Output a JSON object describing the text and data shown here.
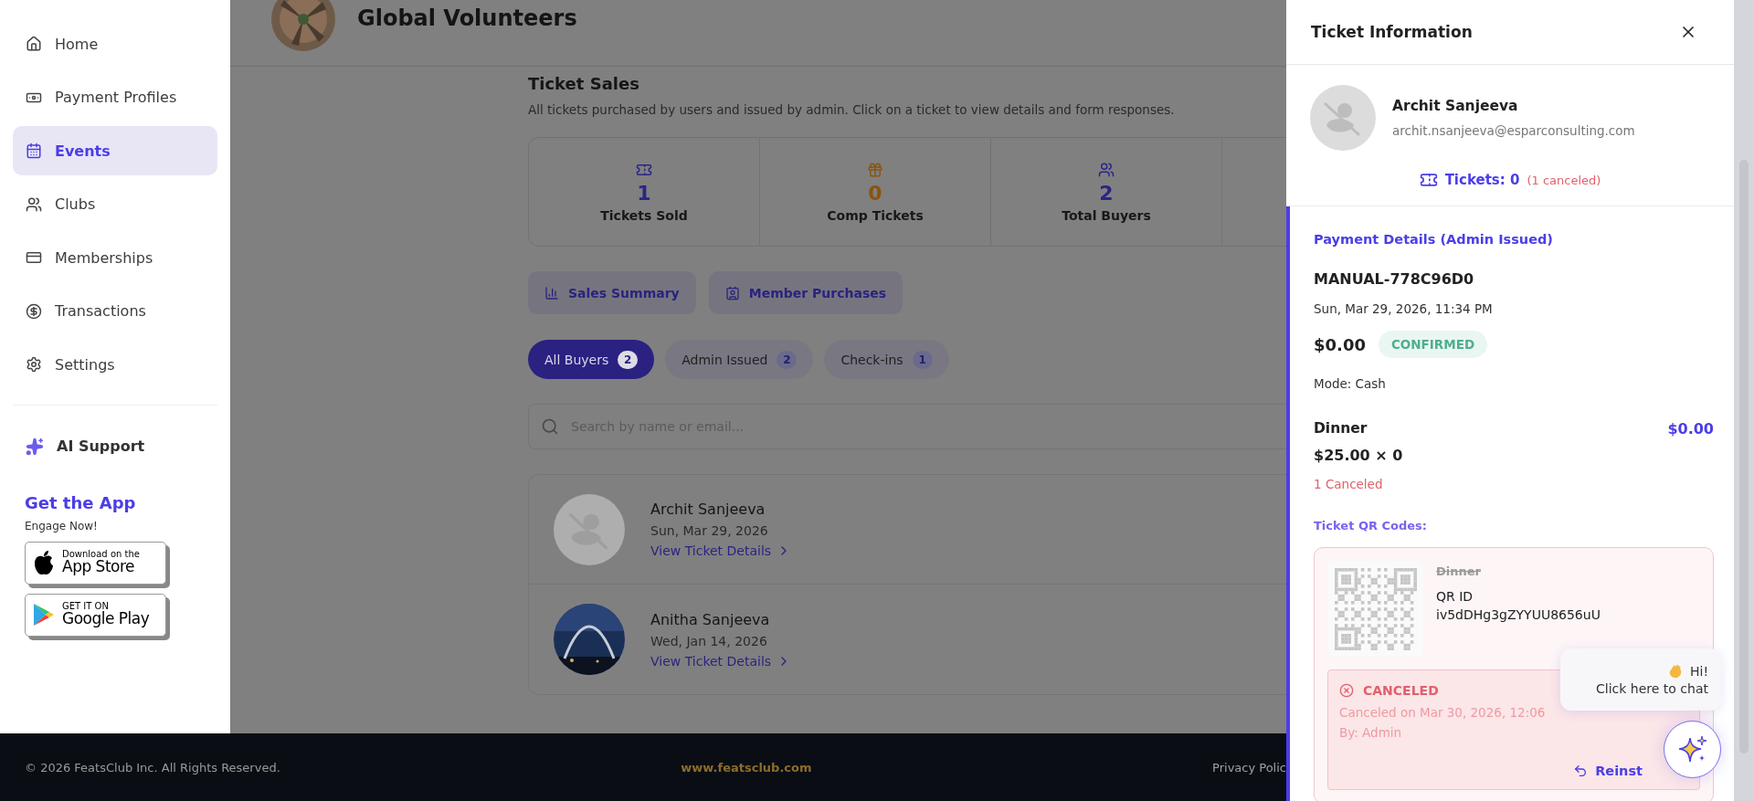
{
  "sidebar": {
    "items": [
      {
        "label": "Home",
        "selected": false
      },
      {
        "label": "Payment Profiles",
        "selected": false
      },
      {
        "label": "Events",
        "selected": true
      },
      {
        "label": "Clubs",
        "selected": false
      },
      {
        "label": "Memberships",
        "selected": false
      },
      {
        "label": "Transactions",
        "selected": false
      },
      {
        "label": "Settings",
        "selected": false
      }
    ],
    "ai_support": {
      "label": "AI Support"
    },
    "app_promo": {
      "title": "Get the App",
      "subtitle": "Engage Now!",
      "stores": [
        {
          "line1": "Download on the",
          "line2": "App Store"
        },
        {
          "line1": "GET IT ON",
          "line2": "Google Play"
        }
      ]
    }
  },
  "header": {
    "title": "Global Volunteers"
  },
  "ticket_sales": {
    "title": "Ticket Sales",
    "description": "All tickets purchased by users and issued by admin. Click on a ticket to view details and form responses.",
    "stats": [
      {
        "value": "1",
        "label": "Tickets Sold",
        "color": "#2b2685"
      },
      {
        "value": "0",
        "label": "Comp Tickets",
        "color": "#8a5410"
      },
      {
        "value": "2",
        "label": "Total Buyers",
        "color": "#2b2685"
      }
    ],
    "actions": [
      "Sales Summary",
      "Member Purchases"
    ],
    "filters": [
      {
        "label": "All Buyers",
        "count": "2",
        "selected": true
      },
      {
        "label": "Admin Issued",
        "count": "2",
        "selected": false
      },
      {
        "label": "Check-ins",
        "count": "1",
        "selected": false
      }
    ],
    "search": {
      "placeholder": "Search by name or email..."
    },
    "buyers": [
      {
        "name": "Archit Sanjeeva",
        "date": "Sun, Mar 29, 2026",
        "link": "View Ticket Details",
        "kind": "placeholder"
      },
      {
        "name": "Anitha Sanjeeva",
        "date": "Wed, Jan 14, 2026",
        "link": "View Ticket Details",
        "kind": "picture"
      }
    ]
  },
  "footer": {
    "copyright": "© 2026 FeatsClub Inc. All Rights Reserved.",
    "website": "www.featsclub.com",
    "privacy": "Privacy Polic"
  },
  "drawer": {
    "title": "Ticket Information",
    "user": {
      "name": "Archit Sanjeeva",
      "email": "archit.nsanjeeva@esparconsulting.com"
    },
    "tickets": {
      "label": "Tickets: 0",
      "canceled": "(1 canceled)"
    },
    "payment": {
      "heading": "Payment Details (Admin Issued)",
      "reference": "MANUAL-778C96D0",
      "date": "Sun, Mar 29, 2026, 11:34 PM",
      "amount": "$0.00",
      "status": "CONFIRMED",
      "mode": "Mode: Cash",
      "items": [
        {
          "name": "Dinner",
          "total": "$0.00",
          "price": "$25.00 × 0",
          "canceled": "1 Canceled"
        }
      ],
      "qr_heading": "Ticket QR Codes:",
      "qr_codes": [
        {
          "item": "Dinner",
          "canceled": true,
          "id_label": "QR ID",
          "id": "iv5dDHg3gZYYUU8656uU",
          "cancel_info": {
            "title": "CANCELED",
            "when": "Canceled on Mar 30, 2026, 12:06",
            "by": "By: Admin",
            "action": "Reinst"
          }
        }
      ]
    }
  },
  "chat": {
    "greeting": "Hi!",
    "prompt": "Click here to chat"
  }
}
